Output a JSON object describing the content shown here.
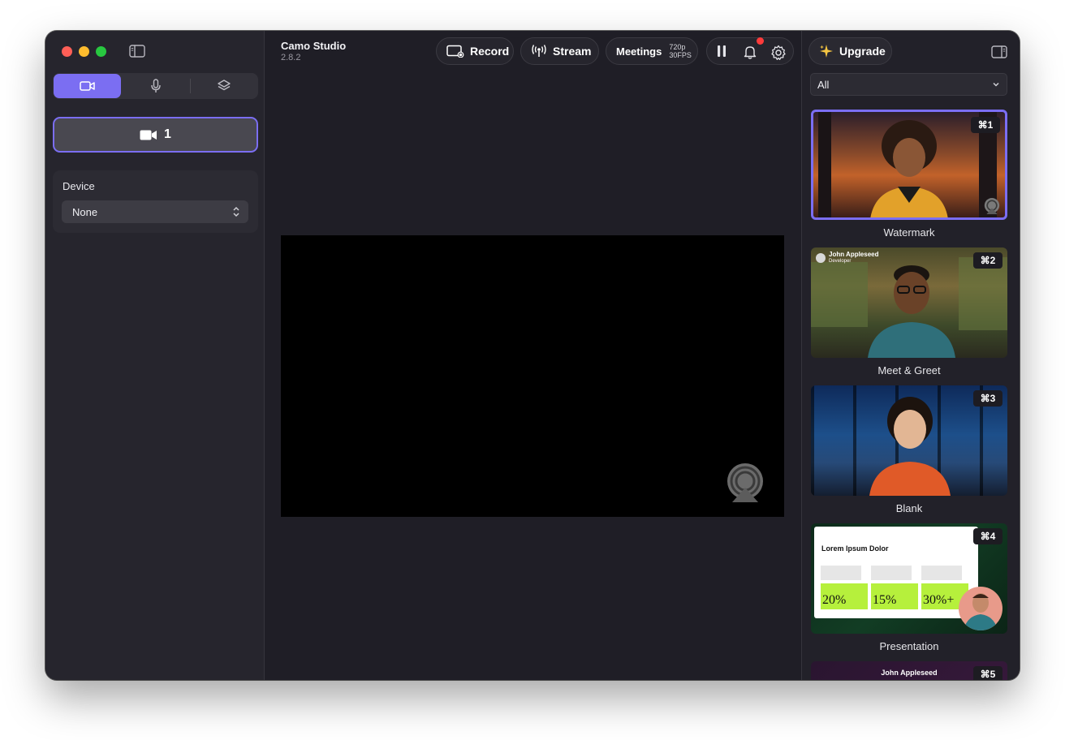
{
  "app": {
    "title": "Camo Studio",
    "version": "2.8.2"
  },
  "toolbar": {
    "record_label": "Record",
    "stream_label": "Stream",
    "meetings_label": "Meetings",
    "resolution": "720p",
    "fps": "30FPS"
  },
  "sidebar": {
    "tabs": [
      "video-icon",
      "microphone-icon",
      "layers-icon"
    ],
    "camera_button_label": "1",
    "device_label": "Device",
    "device_value": "None"
  },
  "right_panel": {
    "upgrade_label": "Upgrade",
    "filter_value": "All",
    "scenes": [
      {
        "label": "Watermark",
        "shortcut": "⌘1",
        "selected": true
      },
      {
        "label": "Meet & Greet",
        "shortcut": "⌘2",
        "overlay_name": "John Appleseed",
        "overlay_sub": "Developer"
      },
      {
        "label": "Blank",
        "shortcut": "⌘3"
      },
      {
        "label": "Presentation",
        "shortcut": "⌘4",
        "slide_title": "Lorem Ipsum Dolor",
        "stats": [
          "20%",
          "15%",
          "30%+"
        ]
      },
      {
        "label": "",
        "shortcut": "⌘5",
        "overlay_name": "John Appleseed"
      }
    ]
  },
  "colors": {
    "accent": "#7b6ef2",
    "window_bg": "#1f1e26",
    "notification": "#ff3b3b",
    "upgrade_sparkle": "#f5c542"
  }
}
